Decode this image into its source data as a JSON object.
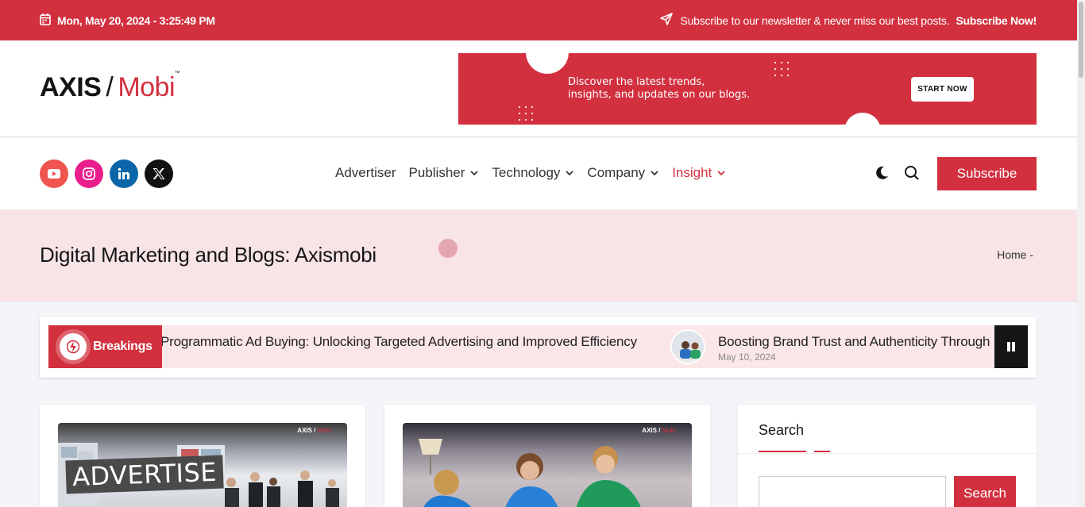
{
  "topbar": {
    "datetime": "Mon, May 20, 2024 - 3:25:49 PM",
    "newsletter_text": "Subscribe to our newsletter & never miss our best posts.",
    "newsletter_link": "Subscribe Now!"
  },
  "logo": {
    "part1": "AXIS",
    "slash": "/",
    "part2": "Mobi",
    "tm": "™"
  },
  "banner": {
    "line1": "Discover the latest trends,",
    "line2": "insights, and updates on our blogs.",
    "button": "START NOW"
  },
  "social": [
    "youtube-icon",
    "instagram-icon",
    "linkedin-icon",
    "x-icon"
  ],
  "nav": {
    "items": [
      {
        "label": "Advertiser",
        "dropdown": false
      },
      {
        "label": "Publisher",
        "dropdown": true
      },
      {
        "label": "Technology",
        "dropdown": true
      },
      {
        "label": "Company",
        "dropdown": true
      },
      {
        "label": "Insight",
        "dropdown": true,
        "active": true
      }
    ],
    "subscribe": "Subscribe"
  },
  "page": {
    "title": "Digital Marketing and Blogs: Axismobi",
    "breadcrumb": "Home -"
  },
  "breaking": {
    "label": "Breakings",
    "item1": "Programmatic Ad Buying: Unlocking Targeted Advertising and Improved Efficiency",
    "item2": "Boosting Brand Trust and Authenticity Through",
    "item2_date": "May 10, 2024"
  },
  "cards": [
    {
      "watermark_a": "AXIS /",
      "watermark_b": "Mobi",
      "sign": "ADVERTISE"
    },
    {
      "watermark_a": "AXIS /",
      "watermark_b": "Mobi"
    }
  ],
  "sidebar": {
    "search_title": "Search",
    "search_button": "Search",
    "search_value": ""
  },
  "colors": {
    "accent": "#d2303f",
    "band": "#f8e4e7"
  }
}
